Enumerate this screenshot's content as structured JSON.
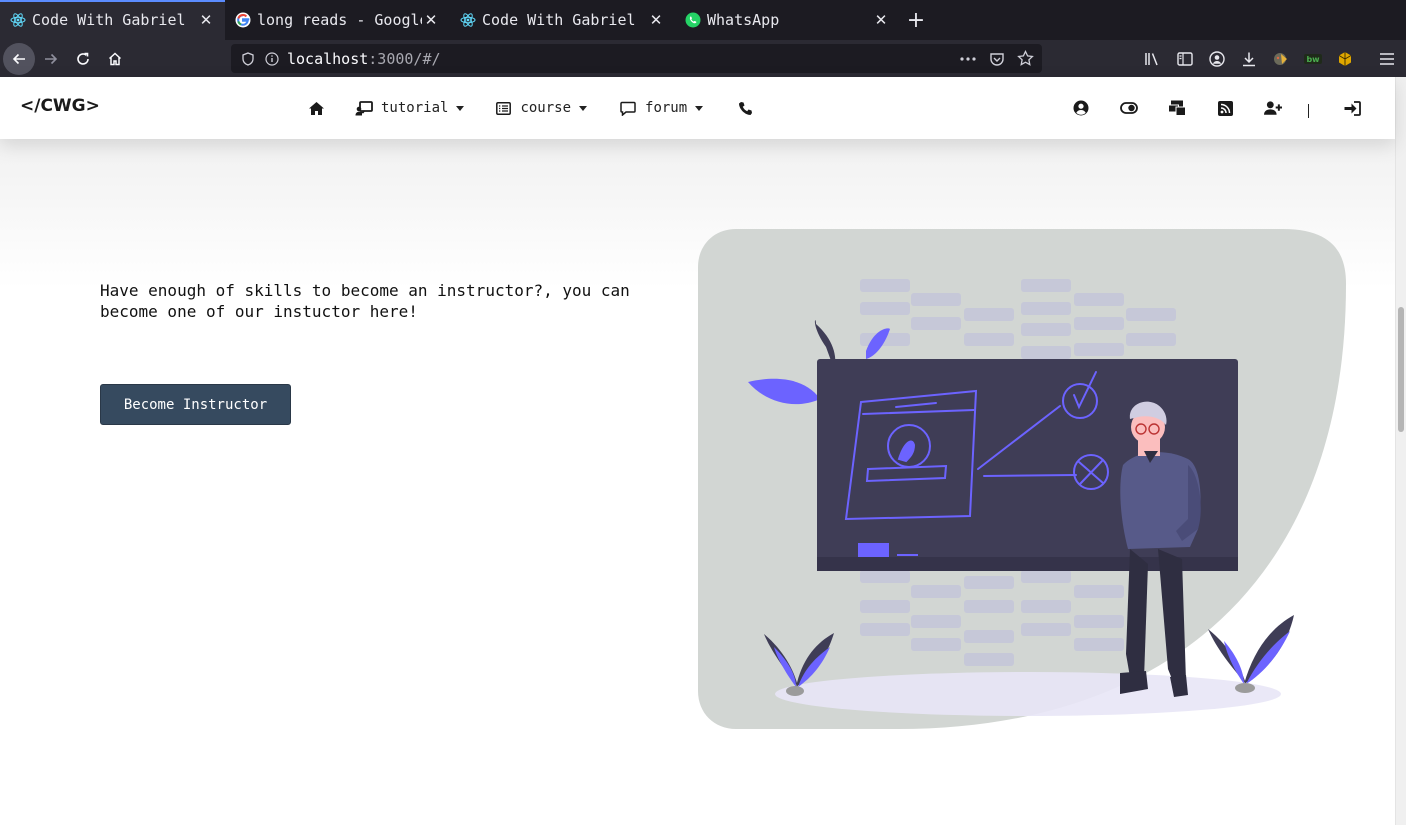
{
  "browser": {
    "tabs": [
      {
        "title": "Code With Gabriel",
        "favicon": "react-icon",
        "active": true
      },
      {
        "title": "long reads - Google",
        "favicon": "google-icon",
        "active": false
      },
      {
        "title": "Code With Gabriel",
        "favicon": "react-icon",
        "active": false
      },
      {
        "title": "WhatsApp",
        "favicon": "whatsapp-icon",
        "active": false
      }
    ],
    "url": {
      "host": "localhost",
      "path": ":3000/#/"
    }
  },
  "site": {
    "logo": "</CWG>",
    "nav": {
      "tutorial": "tutorial",
      "course": "course",
      "forum": "forum"
    },
    "right_divider": "|"
  },
  "hero": {
    "text": "Have enough of skills to become an instructor?, you can become one of our instuctor here!",
    "button": "Become Instructor"
  },
  "colors": {
    "accent": "#6c63ff",
    "button_bg": "#364a5f",
    "chrome_dark": "#1c1b22"
  }
}
